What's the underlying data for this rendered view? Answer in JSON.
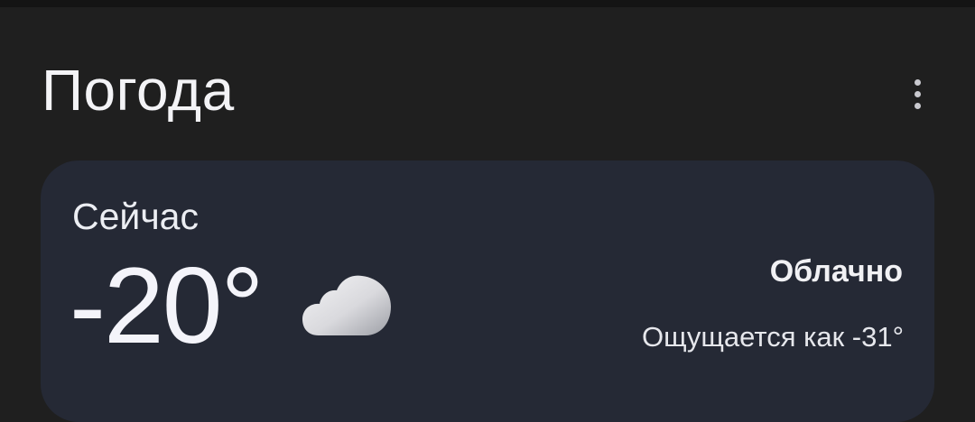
{
  "header": {
    "title": "Погода",
    "menu_icon": "more-vert-icon"
  },
  "current": {
    "label": "Сейчас",
    "temperature": "-20°",
    "condition_icon": "cloud-icon",
    "condition": "Облачно",
    "feels_like": "Ощущается как -31°"
  },
  "colors": {
    "background": "#1f1f1f",
    "card": "#252935",
    "text": "#f1f1f4"
  }
}
